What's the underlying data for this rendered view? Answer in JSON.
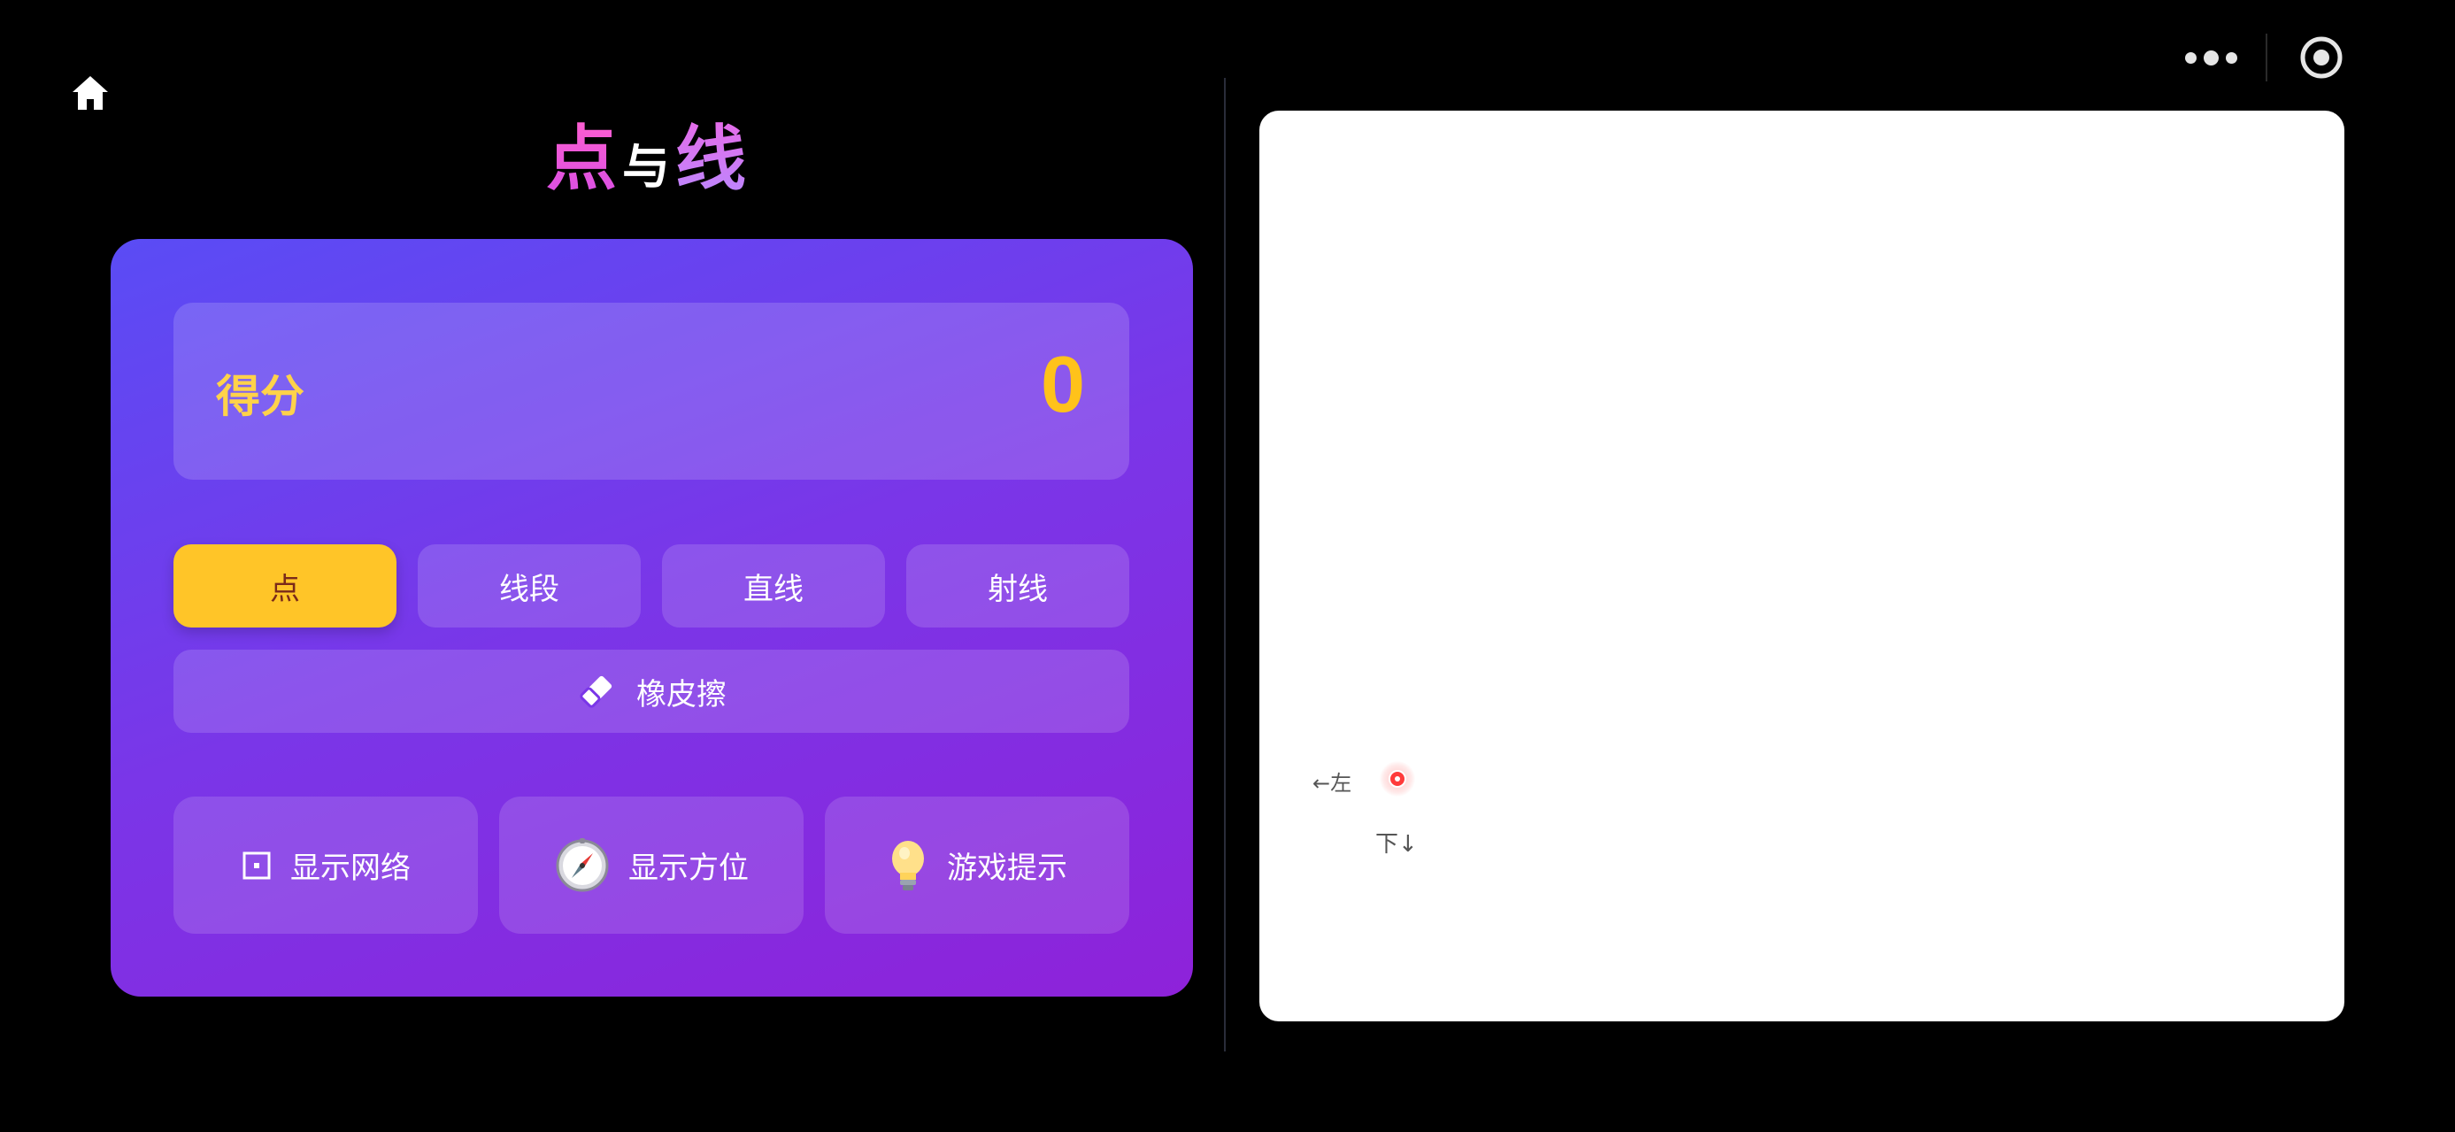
{
  "header": {
    "title_left": "点",
    "title_mid": "与",
    "title_right": "线",
    "icons": {
      "home": "home-icon",
      "more": "more-dots-icon",
      "close": "close-circle-icon"
    }
  },
  "score": {
    "label": "得分",
    "value": "0"
  },
  "tools": [
    {
      "label": "点",
      "active": true
    },
    {
      "label": "线段",
      "active": false
    },
    {
      "label": "直线",
      "active": false
    },
    {
      "label": "射线",
      "active": false
    }
  ],
  "eraser": {
    "label": "橡皮擦",
    "icon": "eraser-icon"
  },
  "options": [
    {
      "label": "显示网络",
      "icon": "grid-square-icon"
    },
    {
      "label": "显示方位",
      "icon": "compass-icon"
    },
    {
      "label": "游戏提示",
      "icon": "lightbulb-icon"
    }
  ],
  "canvas": {
    "left_label": "←左",
    "down_label": "下↓"
  },
  "colors": {
    "accent": "#ffc528",
    "score": "#ffc21a",
    "panel_start": "#5a4cf5",
    "panel_end": "#8e22d9",
    "point": "#ff3b3b"
  }
}
